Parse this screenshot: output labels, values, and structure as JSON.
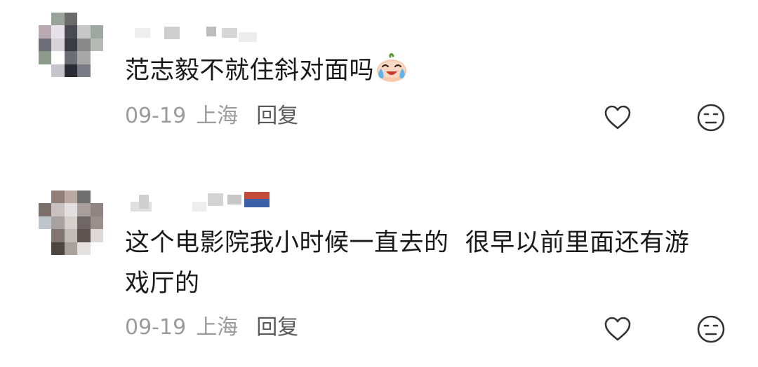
{
  "comments": [
    {
      "text": "范志毅不就住斜对面吗",
      "emoji": "crying-laughing-peach-emoji",
      "date": "09-19",
      "location": "上海",
      "reply_label": "回复",
      "like_icon": "heart-icon",
      "dislike_icon": "meh-face-icon"
    },
    {
      "text_line1": "这个电影院我小时候一直去的  很早以前里面还有游",
      "text_line2": "戏厅的",
      "date": "09-19",
      "location": "上海",
      "reply_label": "回复",
      "like_icon": "heart-icon",
      "dislike_icon": "meh-face-icon"
    }
  ],
  "colors": {
    "text": "#1a1a1a",
    "meta": "#9b9b9b",
    "reply": "#5a5a5a",
    "icon": "#333333"
  }
}
